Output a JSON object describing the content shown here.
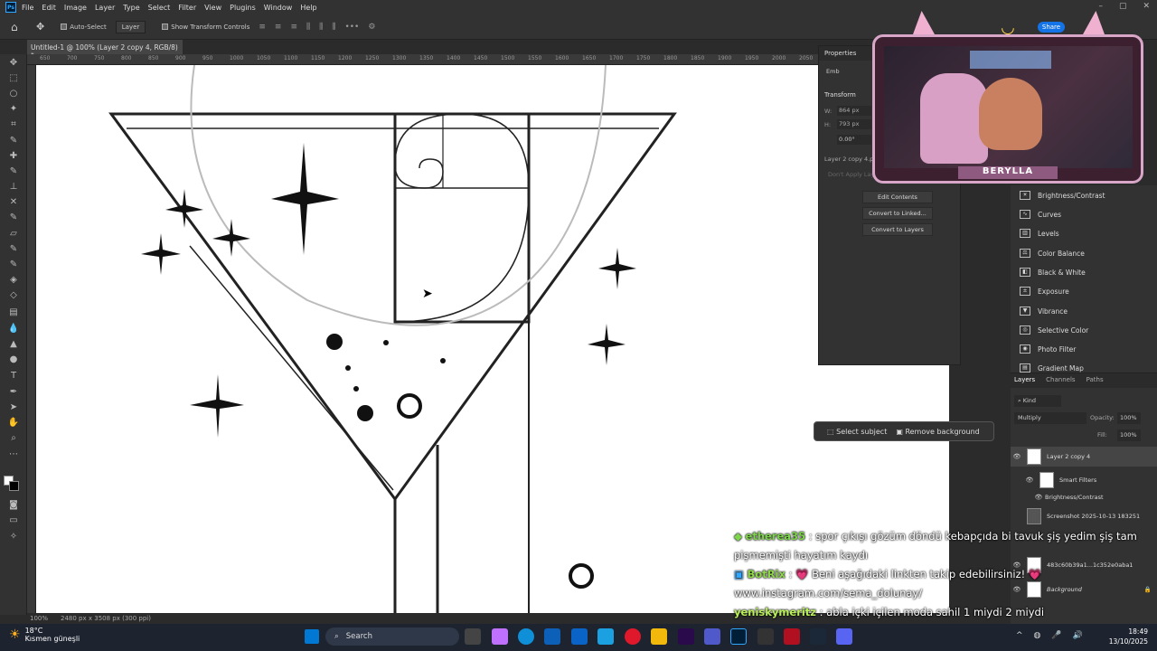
{
  "app": {
    "logo": "Ps"
  },
  "menu": [
    "File",
    "Edit",
    "Image",
    "Layer",
    "Type",
    "Select",
    "Filter",
    "View",
    "Plugins",
    "Window",
    "Help"
  ],
  "window_controls": [
    "–",
    "▢",
    "✕"
  ],
  "options": {
    "auto_select": "Auto-Select",
    "layer_dropdown": "Layer",
    "show_transform": "Show Transform Controls",
    "share": "Share"
  },
  "document_tab": "Untitled-1 @ 100% (Layer 2 copy 4, RGB/8) *",
  "ruler_ticks": [
    "650",
    "700",
    "750",
    "800",
    "850",
    "900",
    "950",
    "1000",
    "1050",
    "1100",
    "1150",
    "1200",
    "1250",
    "1300",
    "1350",
    "1400",
    "1450",
    "1500",
    "1550",
    "1600",
    "1650",
    "1700",
    "1750",
    "1800",
    "1850",
    "1900",
    "1950",
    "2000",
    "2050"
  ],
  "status": {
    "zoom": "100%",
    "doc_info": "2480 px x 3508 px (300 ppi)"
  },
  "properties": {
    "tab1": "Properties",
    "tab2": "Em",
    "embedded": "Emb",
    "transform_title": "Transform",
    "w_label": "W:",
    "w_value": "864 px",
    "h_label": "H:",
    "h_value": "793 px",
    "angle_value": "0.00°",
    "layer_name": "Layer 2 copy 4.p...",
    "dont_apply": "Don't Apply Lay...",
    "edit_contents": "Edit Contents",
    "convert_linked": "Convert to Linked...",
    "convert_layers": "Convert to Layers"
  },
  "webcam": {
    "name": "BERYLLA"
  },
  "adjustments": [
    "Brightness/Contrast",
    "Curves",
    "Levels",
    "Color Balance",
    "Black & White",
    "Exposure",
    "Vibrance",
    "Selective Color",
    "Photo Filter",
    "Gradient Map"
  ],
  "layers_panel": {
    "tabs": [
      "Layers",
      "Channels",
      "Paths"
    ],
    "kind": "Kind",
    "blend_mode": "Multiply",
    "opacity_label": "Opacity:",
    "opacity_value": "100%",
    "fill_label": "Fill:",
    "fill_value": "100%",
    "rows": [
      {
        "name": "Layer 2 copy 4"
      },
      {
        "name": "Smart Filters"
      },
      {
        "name": "Brightness/Contrast"
      },
      {
        "name": "Screenshot 2025-10-13 183251"
      },
      {
        "name": "483c60b39a1...1c352e0aba1"
      },
      {
        "name": "Background"
      }
    ]
  },
  "context_bar": {
    "select_subject": "Select subject",
    "remove_background": "Remove background"
  },
  "chat": [
    {
      "user": "etherea35",
      "sep": " : ",
      "msg": "spor çıkışı gözüm döndü kebapçıda bi tavuk şiş yedim şiş tam pişmemişti hayatım kaydı"
    },
    {
      "user": "BotRix",
      "sep": " : 💗 ",
      "msg": "Beni aşağıdaki linkten takip edebilirsiniz! 💗 www.instagram.com/sema_dolunay/"
    },
    {
      "user": "yeniskymeritz",
      "sep": " : ",
      "msg": "abla içki içilen moda sahil 1 miydi 2 miydi"
    }
  ],
  "taskbar": {
    "weather_temp": "18°C",
    "weather_desc": "Kısmen güneşli",
    "search": "Search",
    "time": "18:49",
    "date": "13/10/2025"
  },
  "colors": {
    "ps_bg": "#323232",
    "canvas": "#ffffff",
    "accent": "#31a8ff",
    "webcam_border": "#d8a7c8"
  }
}
